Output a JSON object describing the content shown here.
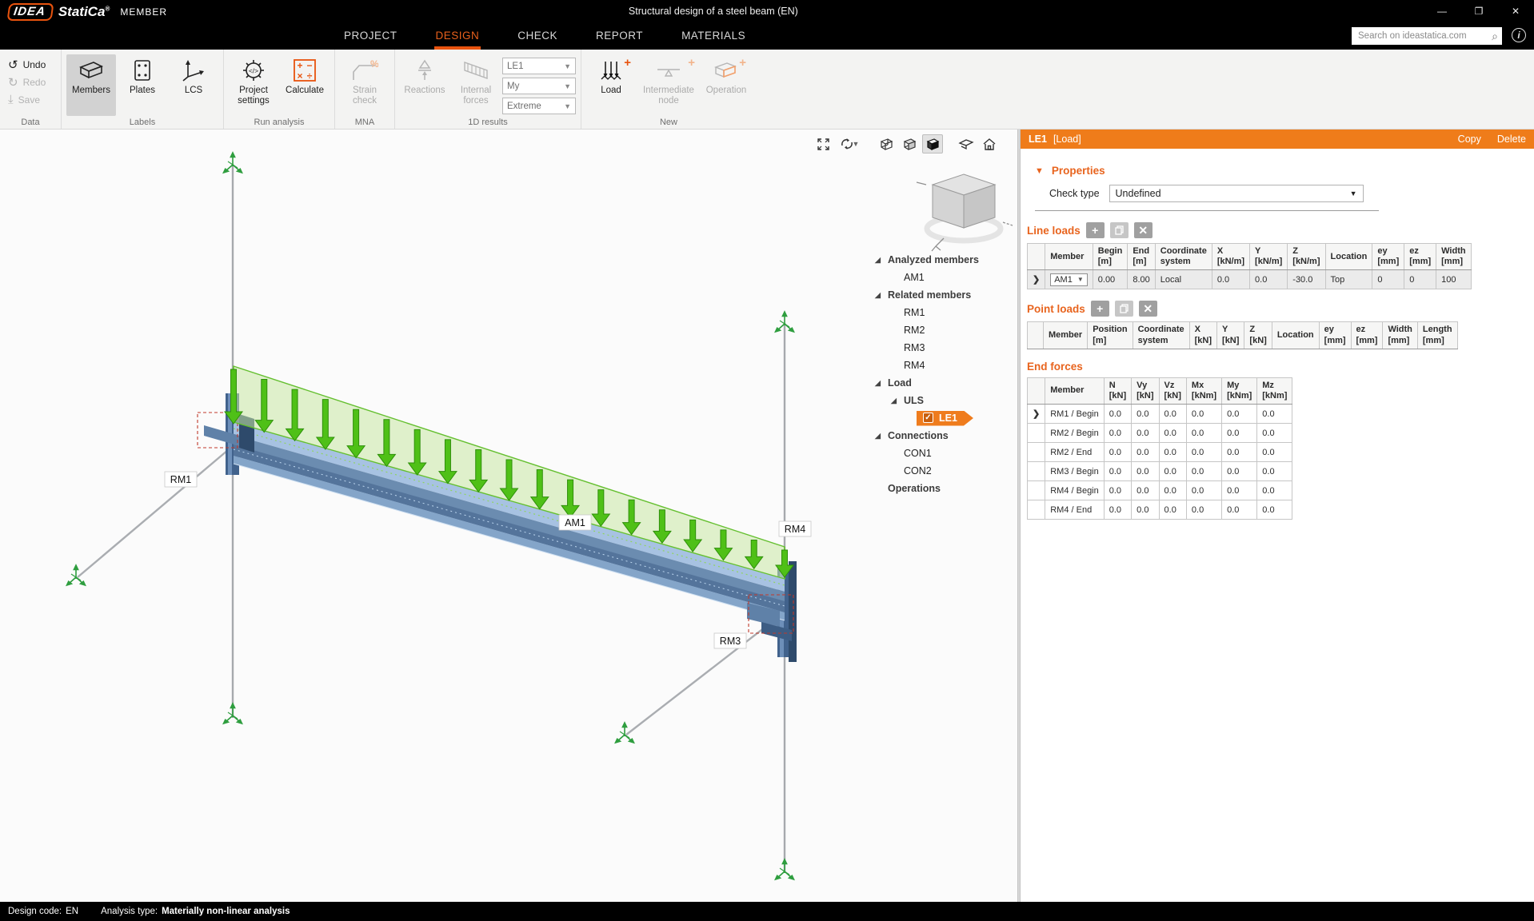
{
  "window": {
    "logo_primary": "IDEA",
    "logo_secondary": "StatiCa",
    "registered": "®",
    "product": "MEMBER",
    "title": "Structural design of a steel beam (EN)",
    "minimize": "—",
    "maximize": "❐",
    "close": "✕"
  },
  "menu": {
    "tabs": [
      {
        "label": "PROJECT",
        "active": false
      },
      {
        "label": "DESIGN",
        "active": true
      },
      {
        "label": "CHECK",
        "active": false
      },
      {
        "label": "REPORT",
        "active": false
      },
      {
        "label": "MATERIALS",
        "active": false
      }
    ],
    "search_placeholder": "Search on ideastatica.com"
  },
  "ribbon": {
    "data_group": {
      "label": "Data",
      "undo": "Undo",
      "redo": "Redo",
      "save": "Save"
    },
    "labels_group": {
      "label": "Labels",
      "members": "Members",
      "plates": "Plates",
      "lcs": "LCS"
    },
    "run_group": {
      "label": "Run analysis",
      "project_settings": "Project settings",
      "calculate": "Calculate"
    },
    "mna_group": {
      "label": "MNA",
      "strain_check": "Strain check"
    },
    "results_group": {
      "label": "1D results",
      "reactions": "Reactions",
      "internal_forces": "Internal forces",
      "dropdowns": [
        "LE1",
        "My",
        "Extreme"
      ]
    },
    "new_group": {
      "label": "New",
      "load": "Load",
      "intermediate_node": "Intermediate node",
      "operation": "Operation"
    }
  },
  "viewport": {
    "member_labels": [
      "RM1",
      "AM1",
      "RM4",
      "RM3"
    ]
  },
  "tree": {
    "items": [
      {
        "label": "Analyzed members",
        "level": 0,
        "bold": true,
        "expandable": true
      },
      {
        "label": "AM1",
        "level": 1,
        "bold": false,
        "expandable": false
      },
      {
        "label": "Related members",
        "level": 0,
        "bold": true,
        "expandable": true
      },
      {
        "label": "RM1",
        "level": 1,
        "bold": false,
        "expandable": false
      },
      {
        "label": "RM2",
        "level": 1,
        "bold": false,
        "expandable": false
      },
      {
        "label": "RM3",
        "level": 1,
        "bold": false,
        "expandable": false
      },
      {
        "label": "RM4",
        "level": 1,
        "bold": false,
        "expandable": false
      },
      {
        "label": "Load",
        "level": 0,
        "bold": true,
        "expandable": true
      },
      {
        "label": "ULS",
        "level": 1,
        "bold": true,
        "expandable": true
      },
      {
        "label": "LE1",
        "level": 2,
        "bold": true,
        "expandable": false,
        "selected": true,
        "checked": true
      },
      {
        "label": "Connections",
        "level": 0,
        "bold": true,
        "expandable": true
      },
      {
        "label": "CON1",
        "level": 1,
        "bold": false,
        "expandable": false
      },
      {
        "label": "CON2",
        "level": 1,
        "bold": false,
        "expandable": false
      },
      {
        "label": "Operations",
        "level": 0,
        "bold": true,
        "expandable": false
      }
    ]
  },
  "panel": {
    "header": {
      "title": "LE1",
      "type": "[Load]",
      "copy": "Copy",
      "delete": "Delete"
    },
    "properties": {
      "title": "Properties",
      "check_type_label": "Check type",
      "check_type_value": "Undefined"
    },
    "line_loads": {
      "title": "Line loads",
      "headers": [
        [
          "",
          ""
        ],
        [
          "Member",
          ""
        ],
        [
          "Begin",
          "[m]"
        ],
        [
          "End",
          "[m]"
        ],
        [
          "Coordinate",
          "system"
        ],
        [
          "X",
          "[kN/m]"
        ],
        [
          "Y",
          "[kN/m]"
        ],
        [
          "Z",
          "[kN/m]"
        ],
        [
          "Location",
          ""
        ],
        [
          "ey",
          "[mm]"
        ],
        [
          "ez",
          "[mm]"
        ],
        [
          "Width",
          "[mm]"
        ]
      ],
      "rows": [
        [
          "AM1",
          "0.00",
          "8.00",
          "Local",
          "0.0",
          "0.0",
          "-30.0",
          "Top",
          "0",
          "0",
          "100"
        ]
      ]
    },
    "point_loads": {
      "title": "Point loads",
      "headers": [
        [
          "",
          ""
        ],
        [
          "Member",
          ""
        ],
        [
          "Position",
          "[m]"
        ],
        [
          "Coordinate",
          "system"
        ],
        [
          "X",
          "[kN]"
        ],
        [
          "Y",
          "[kN]"
        ],
        [
          "Z",
          "[kN]"
        ],
        [
          "Location",
          ""
        ],
        [
          "ey",
          "[mm]"
        ],
        [
          "ez",
          "[mm]"
        ],
        [
          "Width",
          "[mm]"
        ],
        [
          "Length",
          "[mm]"
        ]
      ],
      "rows": []
    },
    "end_forces": {
      "title": "End forces",
      "headers": [
        [
          "",
          ""
        ],
        [
          "Member",
          ""
        ],
        [
          "N",
          "[kN]"
        ],
        [
          "Vy",
          "[kN]"
        ],
        [
          "Vz",
          "[kN]"
        ],
        [
          "Mx",
          "[kNm]"
        ],
        [
          "My",
          "[kNm]"
        ],
        [
          "Mz",
          "[kNm]"
        ]
      ],
      "rows": [
        [
          "RM1 / Begin",
          "0.0",
          "0.0",
          "0.0",
          "0.0",
          "0.0",
          "0.0"
        ],
        [
          "RM2 / Begin",
          "0.0",
          "0.0",
          "0.0",
          "0.0",
          "0.0",
          "0.0"
        ],
        [
          "RM2 / End",
          "0.0",
          "0.0",
          "0.0",
          "0.0",
          "0.0",
          "0.0"
        ],
        [
          "RM3 / Begin",
          "0.0",
          "0.0",
          "0.0",
          "0.0",
          "0.0",
          "0.0"
        ],
        [
          "RM4 / Begin",
          "0.0",
          "0.0",
          "0.0",
          "0.0",
          "0.0",
          "0.0"
        ],
        [
          "RM4 / End",
          "0.0",
          "0.0",
          "0.0",
          "0.0",
          "0.0",
          "0.0"
        ]
      ]
    }
  },
  "statusbar": {
    "design_code_label": "Design code:",
    "design_code_value": "EN",
    "analysis_label": "Analysis type:",
    "analysis_value": "Materially non-linear analysis"
  },
  "colors": {
    "accent_orange": "#e8530e",
    "panel_orange": "#ef7c1a",
    "load_green": "#4cbb17",
    "steel_blue": "#7d9fc6"
  }
}
